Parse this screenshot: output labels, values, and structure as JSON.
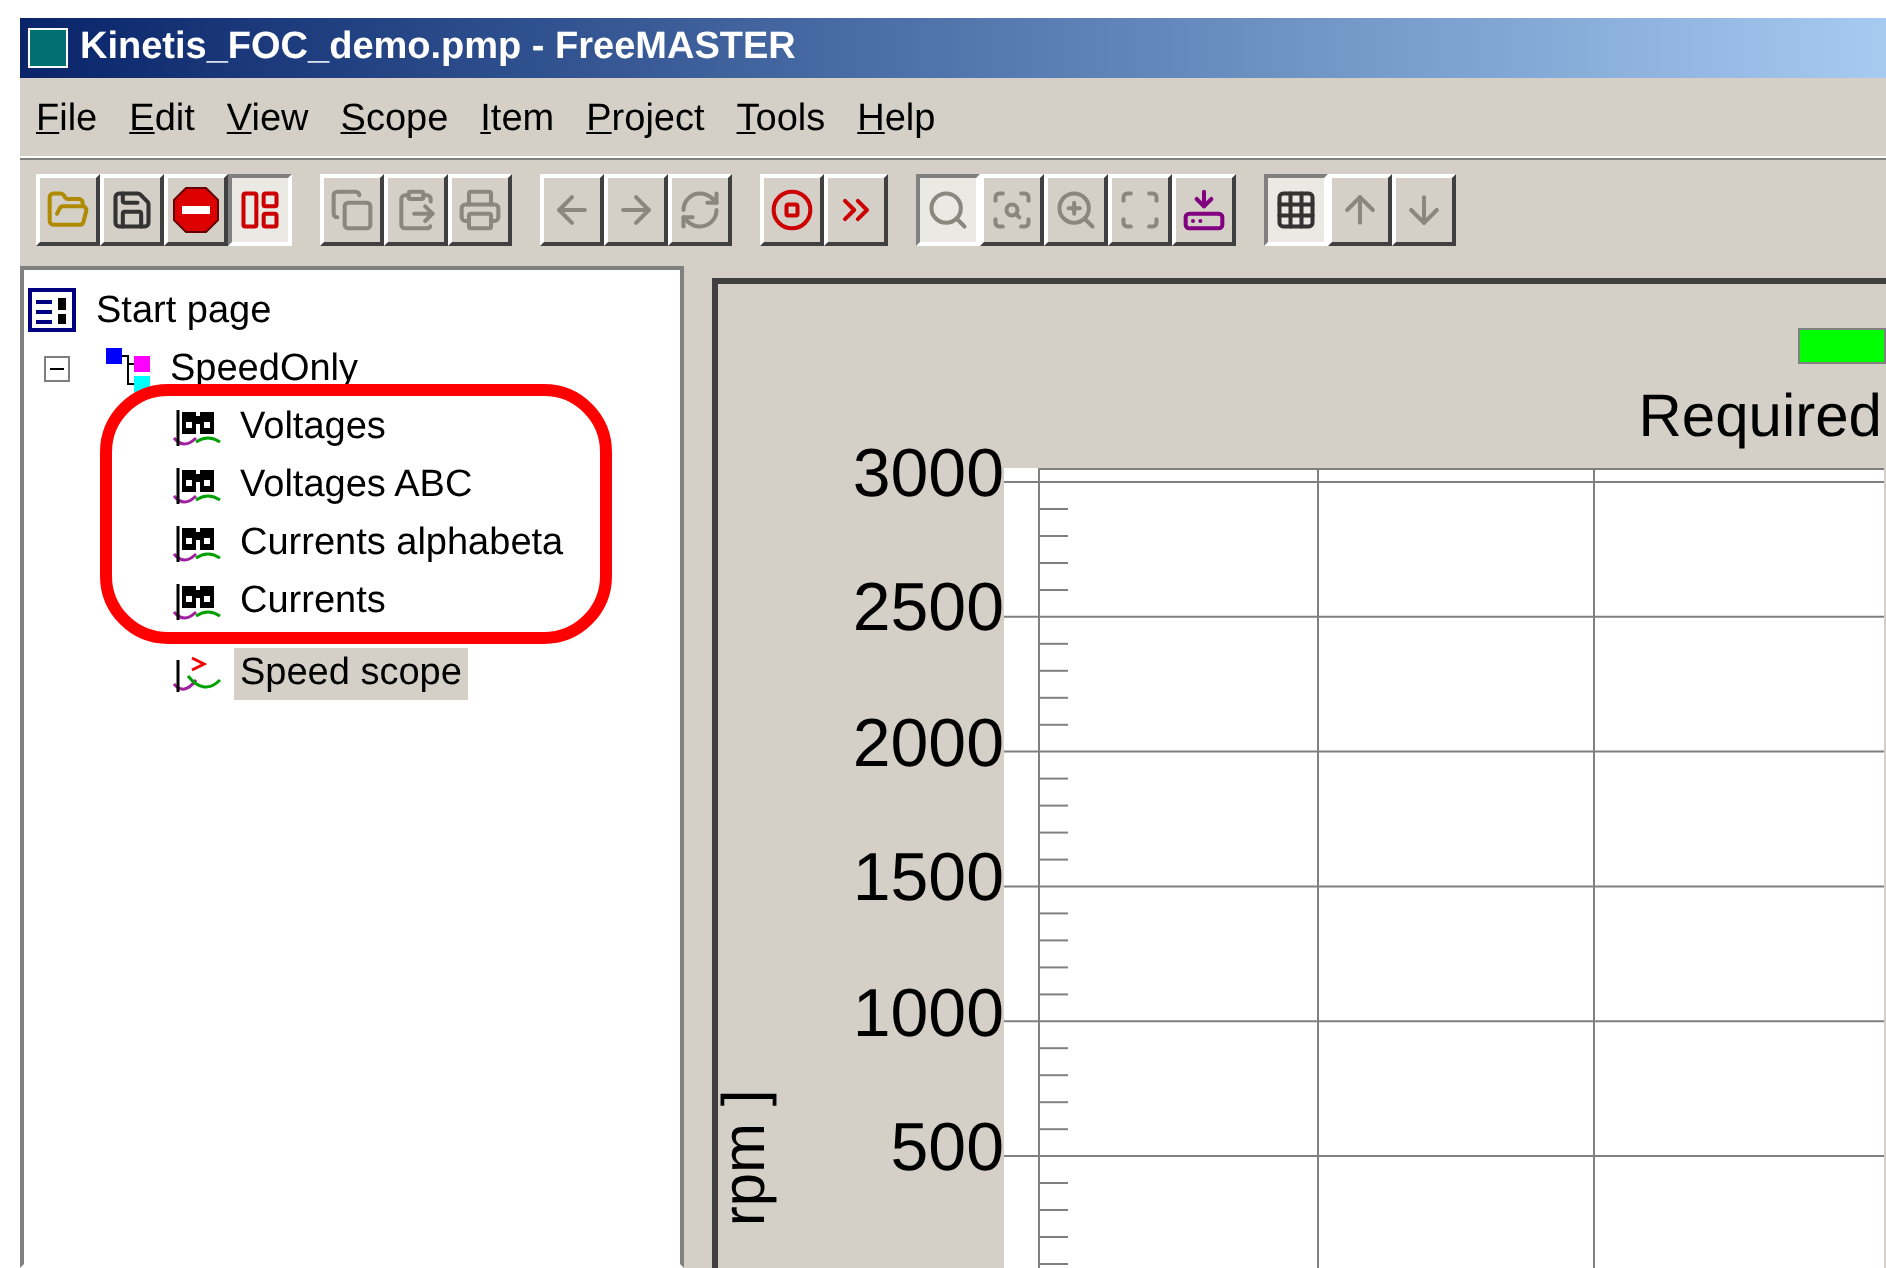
{
  "window": {
    "title": "Kinetis_FOC_demo.pmp - FreeMASTER"
  },
  "menu": [
    {
      "label": "File"
    },
    {
      "label": "Edit"
    },
    {
      "label": "View"
    },
    {
      "label": "Scope"
    },
    {
      "label": "Item"
    },
    {
      "label": "Project"
    },
    {
      "label": "Tools"
    },
    {
      "label": "Help"
    }
  ],
  "toolbar": [
    [
      {
        "kind": "open",
        "disabled": false,
        "pressed": false
      },
      {
        "kind": "save",
        "disabled": false,
        "pressed": false
      },
      {
        "kind": "stop",
        "disabled": false,
        "pressed": false
      },
      {
        "kind": "watch",
        "disabled": false,
        "pressed": true
      }
    ],
    [
      {
        "kind": "copy",
        "disabled": true,
        "pressed": false
      },
      {
        "kind": "paste",
        "disabled": true,
        "pressed": false
      },
      {
        "kind": "print",
        "disabled": true,
        "pressed": false
      }
    ],
    [
      {
        "kind": "back",
        "disabled": true,
        "pressed": false
      },
      {
        "kind": "forward",
        "disabled": true,
        "pressed": false
      },
      {
        "kind": "refresh",
        "disabled": true,
        "pressed": false
      }
    ],
    [
      {
        "kind": "stop-record",
        "disabled": false,
        "pressed": false
      },
      {
        "kind": "fast-forward",
        "disabled": false,
        "pressed": false
      }
    ],
    [
      {
        "kind": "probe",
        "disabled": true,
        "pressed": true
      },
      {
        "kind": "probe-edit",
        "disabled": true,
        "pressed": false
      },
      {
        "kind": "probe-go",
        "disabled": true,
        "pressed": false
      },
      {
        "kind": "scan",
        "disabled": true,
        "pressed": false
      },
      {
        "kind": "export",
        "disabled": false,
        "pressed": false
      }
    ],
    [
      {
        "kind": "grid",
        "disabled": false,
        "pressed": true
      },
      {
        "kind": "up",
        "disabled": true,
        "pressed": false
      },
      {
        "kind": "down",
        "disabled": true,
        "pressed": false
      }
    ]
  ],
  "tree": [
    {
      "label": "Start page",
      "kind": "page",
      "selected": false
    },
    {
      "label": "SpeedOnly",
      "kind": "block",
      "selected": false,
      "expanded": true,
      "children": [
        {
          "label": "Voltages",
          "kind": "scope",
          "selected": false,
          "highlighted": true
        },
        {
          "label": "Voltages ABC",
          "kind": "scope",
          "selected": false,
          "highlighted": true
        },
        {
          "label": "Currents alphabeta",
          "kind": "scope",
          "selected": false,
          "highlighted": true
        },
        {
          "label": "Currents",
          "kind": "scope",
          "selected": false,
          "highlighted": true
        },
        {
          "label": "Speed scope",
          "kind": "recorder",
          "selected": true,
          "highlighted": false
        }
      ]
    }
  ],
  "scope": {
    "legend": {
      "color": "#00ff00"
    },
    "title": "Required",
    "ylabel": "rpm ]",
    "yticks": [
      "3000",
      "2500",
      "2000",
      "1500",
      "1000",
      "500"
    ]
  }
}
